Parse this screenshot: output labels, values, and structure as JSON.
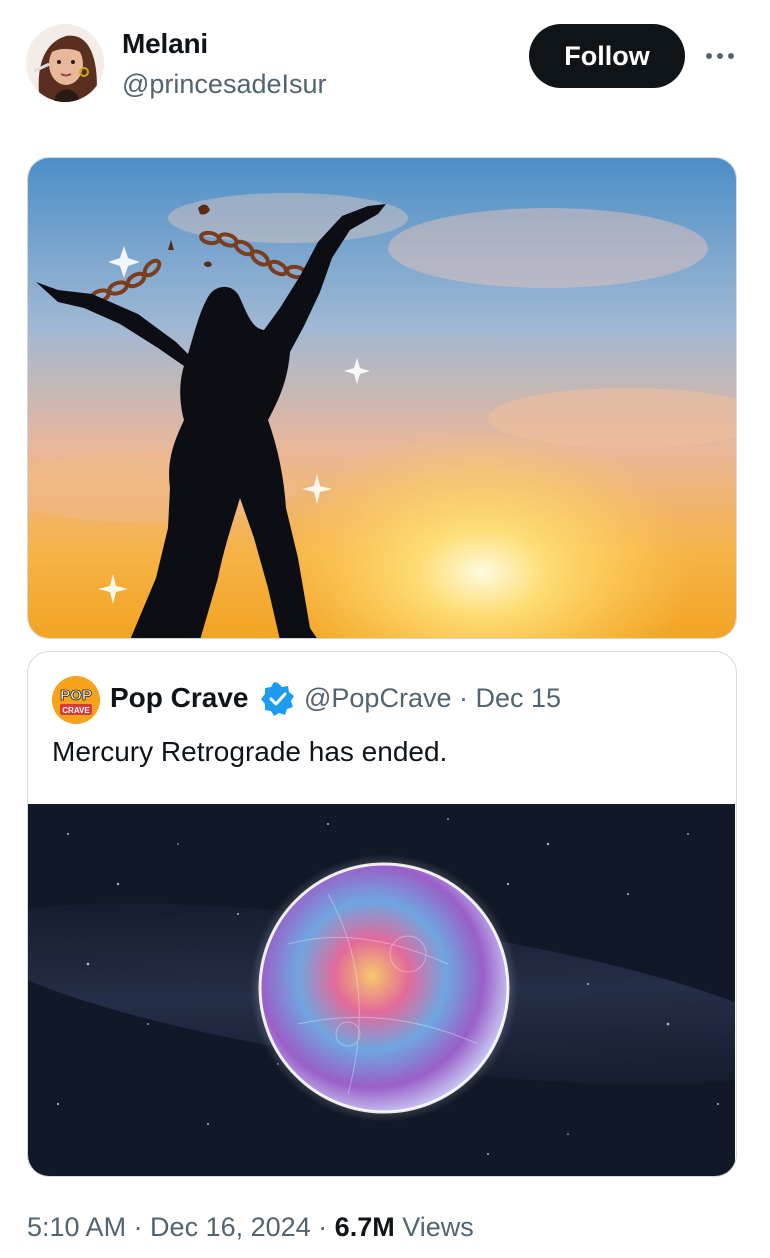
{
  "author": {
    "display_name": "Melani",
    "handle": "@princesadeIsur",
    "avatar_icon": "cartoon-woman-avatar"
  },
  "header": {
    "follow_label": "Follow",
    "more_icon": "more-dots-icon"
  },
  "media": {
    "description_icon": "sunset-silhouette-broken-chains-image"
  },
  "quote": {
    "avatar_text_top": "POP",
    "avatar_text_bottom": "CRAVE",
    "display_name": "Pop Crave",
    "handle_date": "@PopCrave · Dec 15",
    "text": "Mercury Retrograde has ended.",
    "media_icon": "mercury-planet-image",
    "verified_icon": "verified-badge-icon"
  },
  "footer": {
    "time_date": "5:10 AM · Dec 16, 2024 · ",
    "views_count": "6.7M",
    "views_label": " Views"
  },
  "colors": {
    "accent": "#0f1419",
    "secondary_text": "#536471",
    "verified_blue": "#1d9bf0",
    "border": "#cfd9de"
  }
}
